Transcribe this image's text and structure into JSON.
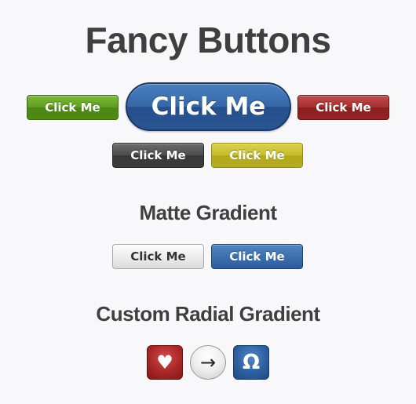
{
  "page": {
    "title": "Fancy Buttons"
  },
  "fancy_buttons": [
    {
      "label": "Click Me",
      "color": "#5e9b1f"
    },
    {
      "label": "Click Me",
      "color": "#3567a6"
    },
    {
      "label": "Click Me",
      "color": "#a32f2f"
    },
    {
      "label": "Click Me",
      "color": "#4c4c4c"
    },
    {
      "label": "Click Me",
      "color": "#c6bc2c"
    }
  ],
  "matte_section": {
    "heading": "Matte Gradient",
    "buttons": [
      {
        "label": "Click Me",
        "color": "#ececec"
      },
      {
        "label": "Click Me",
        "color": "#3c70ae"
      }
    ]
  },
  "radial_section": {
    "heading": "Custom Radial Gradient",
    "buttons": [
      {
        "glyph": "♥",
        "icon": "heart-icon",
        "color": "#a42525"
      },
      {
        "glyph": "→",
        "icon": "arrow-right-icon",
        "color": "#ececec"
      },
      {
        "glyph": "Ω",
        "icon": "omega-icon",
        "color": "#2c5d9c"
      }
    ]
  }
}
